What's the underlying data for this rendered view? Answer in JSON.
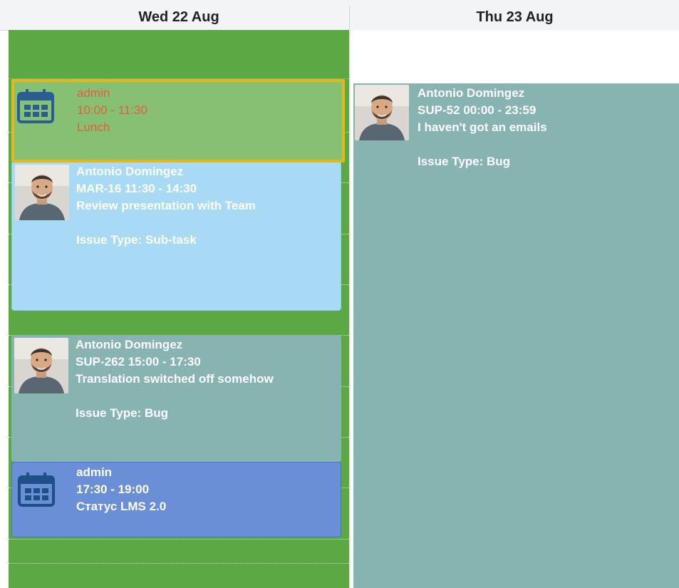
{
  "days": [
    {
      "label": "Wed 22 Aug"
    },
    {
      "label": "Thu 23 Aug"
    }
  ],
  "events": {
    "lunch": {
      "user": "admin",
      "time": "10:00 - 11:30",
      "title": "Lunch",
      "icon": "calendar-icon"
    },
    "review": {
      "user": "Antonio Domingez",
      "key_time": "MAR-16  11:30 - 14:30",
      "title": "Review presentation with Team",
      "issue_type": "Issue Type: Sub-task"
    },
    "translation": {
      "user": "Antonio Domingez",
      "key_time": "SUP-262  15:00 - 17:30",
      "title": "Translation switched off somehow",
      "issue_type": "Issue Type: Bug"
    },
    "status": {
      "user": "admin",
      "time": "17:30 - 19:00",
      "title": "Статус LMS 2.0",
      "icon": "calendar-icon"
    },
    "thu_bug": {
      "user": "Antonio Domingez",
      "key_time": "SUP-52  00:00 - 23:59",
      "title": "I haven't got an emails",
      "issue_type": "Issue Type: Bug"
    }
  },
  "colors": {
    "wed_column": "#5ca844",
    "lunch_bg": "#86c072",
    "lunch_border": "#e1b81f",
    "lunch_text": "#ea5b3f",
    "subtask_bg": "#a8daf6",
    "bug_bg": "#87b3b1",
    "admin_event_bg": "#6b8fd6"
  }
}
